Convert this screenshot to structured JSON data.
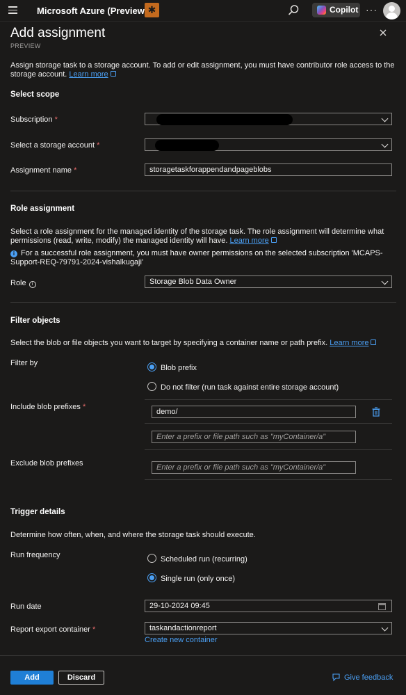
{
  "topbar": {
    "title": "Microsoft Azure (Preview)",
    "copilot_label": "Copilot",
    "more_label": "···"
  },
  "panel": {
    "title": "Add assignment",
    "subtitle": "PREVIEW",
    "intro": "Assign storage task to a storage account. To add or edit assignment, you must have contributor role access to the storage account.",
    "learn_more": "Learn more"
  },
  "scope": {
    "heading": "Select scope",
    "subscription_label": "Subscription",
    "storage_account_label": "Select a storage account",
    "assignment_name_label": "Assignment name",
    "assignment_name_value": "storagetaskforappendandpageblobs"
  },
  "role": {
    "heading": "Role assignment",
    "description": "Select a role assignment for the managed identity of the storage task. The role assignment will determine what permissions (read, write, modify) the managed identity will have.",
    "learn_more": "Learn more",
    "info": "For a successful role assignment, you must have owner permissions on the selected subscription 'MCAPS-Support-REQ-79791-2024-vishalkugaji'",
    "role_label": "Role",
    "role_value": "Storage Blob Data Owner"
  },
  "filter": {
    "heading": "Filter objects",
    "description": "Select the blob or file objects you want to target by specifying a container name or path prefix.",
    "learn_more": "Learn more",
    "filter_by_label": "Filter by",
    "option_blob_prefix": "Blob prefix",
    "option_no_filter": "Do not filter (run task against entire storage account)",
    "selected": "Blob prefix",
    "include_label": "Include blob prefixes",
    "include_value": "demo/",
    "prefix_placeholder": "Enter a prefix or file path such as \"myContainer/a\"",
    "exclude_label": "Exclude blob prefixes"
  },
  "trigger": {
    "heading": "Trigger details",
    "description": "Determine how often, when, and where the storage task should execute.",
    "frequency_label": "Run frequency",
    "option_scheduled": "Scheduled run (recurring)",
    "option_single": "Single run (only once)",
    "selected": "Single run (only once)",
    "run_date_label": "Run date",
    "run_date_value": "29-10-2024 09:45",
    "container_label": "Report export container",
    "container_value": "taskandactionreport",
    "create_container": "Create new container"
  },
  "footer": {
    "add_label": "Add",
    "discard_label": "Discard",
    "feedback_label": "Give feedback"
  },
  "required_marker": "*",
  "colors": {
    "accent": "#4ba0f5",
    "primary_button": "#1f7fd6",
    "background": "#1b1a19",
    "required": "#e86c6c"
  }
}
